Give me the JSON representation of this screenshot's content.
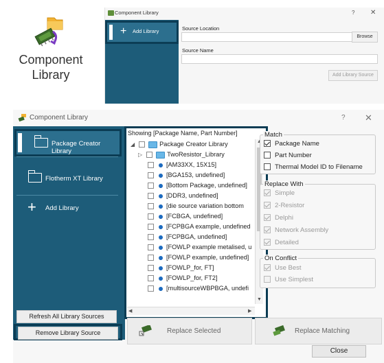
{
  "hero": {
    "title_line1": "Component",
    "title_line2": "Library",
    "icon": "component-library-icon"
  },
  "preview_dialog": {
    "title": "Component Library",
    "help": "?",
    "close": "✕",
    "add_library_label": "Add Library",
    "source_location_label": "Source Location",
    "source_location_value": "",
    "browse_label": "Browse",
    "source_name_label": "Source Name",
    "source_name_value": "",
    "add_source_label": "Add Library Source"
  },
  "window": {
    "title": "Component Library",
    "help": "?",
    "close": "✕"
  },
  "sidebar": {
    "items": [
      {
        "label": "Package Creator Library",
        "icon": "folder-icon",
        "selected": true
      },
      {
        "label": "Flotherm XT Library",
        "icon": "folder-icon",
        "selected": false
      },
      {
        "label": "Add Library",
        "icon": "plus-icon",
        "selected": false
      }
    ],
    "refresh_label": "Refresh All Library Sources",
    "remove_label": "Remove Library Source"
  },
  "tree": {
    "header": "Showing [Package Name, Part Number]",
    "root": "Package Creator Library",
    "folder": "TwoResistor_Library",
    "items": [
      "[AM33XX, 15X15]",
      "[BGA153, undefined]",
      "[Bottom Package, undefined]",
      "[DDR3, undefined]",
      "[die source variation bottom",
      "[FCBGA, undefined]",
      "[FCPBGA example, undefined",
      "[FCPBGA, undefined]",
      "[FOWLP example metalised, u",
      "[FOWLP example, undefined]",
      "[FOWLP_for, FT]",
      "[FOWLP_for, FT2]",
      "[multisourceWBPBGA, undefi"
    ]
  },
  "match": {
    "title": "Match",
    "options": [
      {
        "label": "Package Name",
        "checked": true
      },
      {
        "label": "Part Number",
        "checked": false
      },
      {
        "label": "Thermal Model ID to Filename",
        "checked": false
      }
    ]
  },
  "replace_with": {
    "title": "Replace With",
    "options": [
      {
        "label": "Simple",
        "checked": true
      },
      {
        "label": "2-Resistor",
        "checked": true
      },
      {
        "label": "Delphi",
        "checked": true
      },
      {
        "label": "Network Assembly",
        "checked": true
      },
      {
        "label": "Detailed",
        "checked": true
      }
    ]
  },
  "on_conflict": {
    "title": "On Conflict",
    "options": [
      {
        "label": "Use Best",
        "checked": true
      },
      {
        "label": "Use Simplest",
        "checked": false
      }
    ]
  },
  "actions": {
    "replace_selected": "Replace Selected",
    "replace_matching": "Replace Matching",
    "close": "Close"
  },
  "colors": {
    "sidebar": "#1d5c79",
    "sidebar_selected": "#2c6f8e",
    "highlight_border": "#0b3c54",
    "folder_blue": "#69b7e7",
    "item_dot": "#1d6bbf"
  }
}
